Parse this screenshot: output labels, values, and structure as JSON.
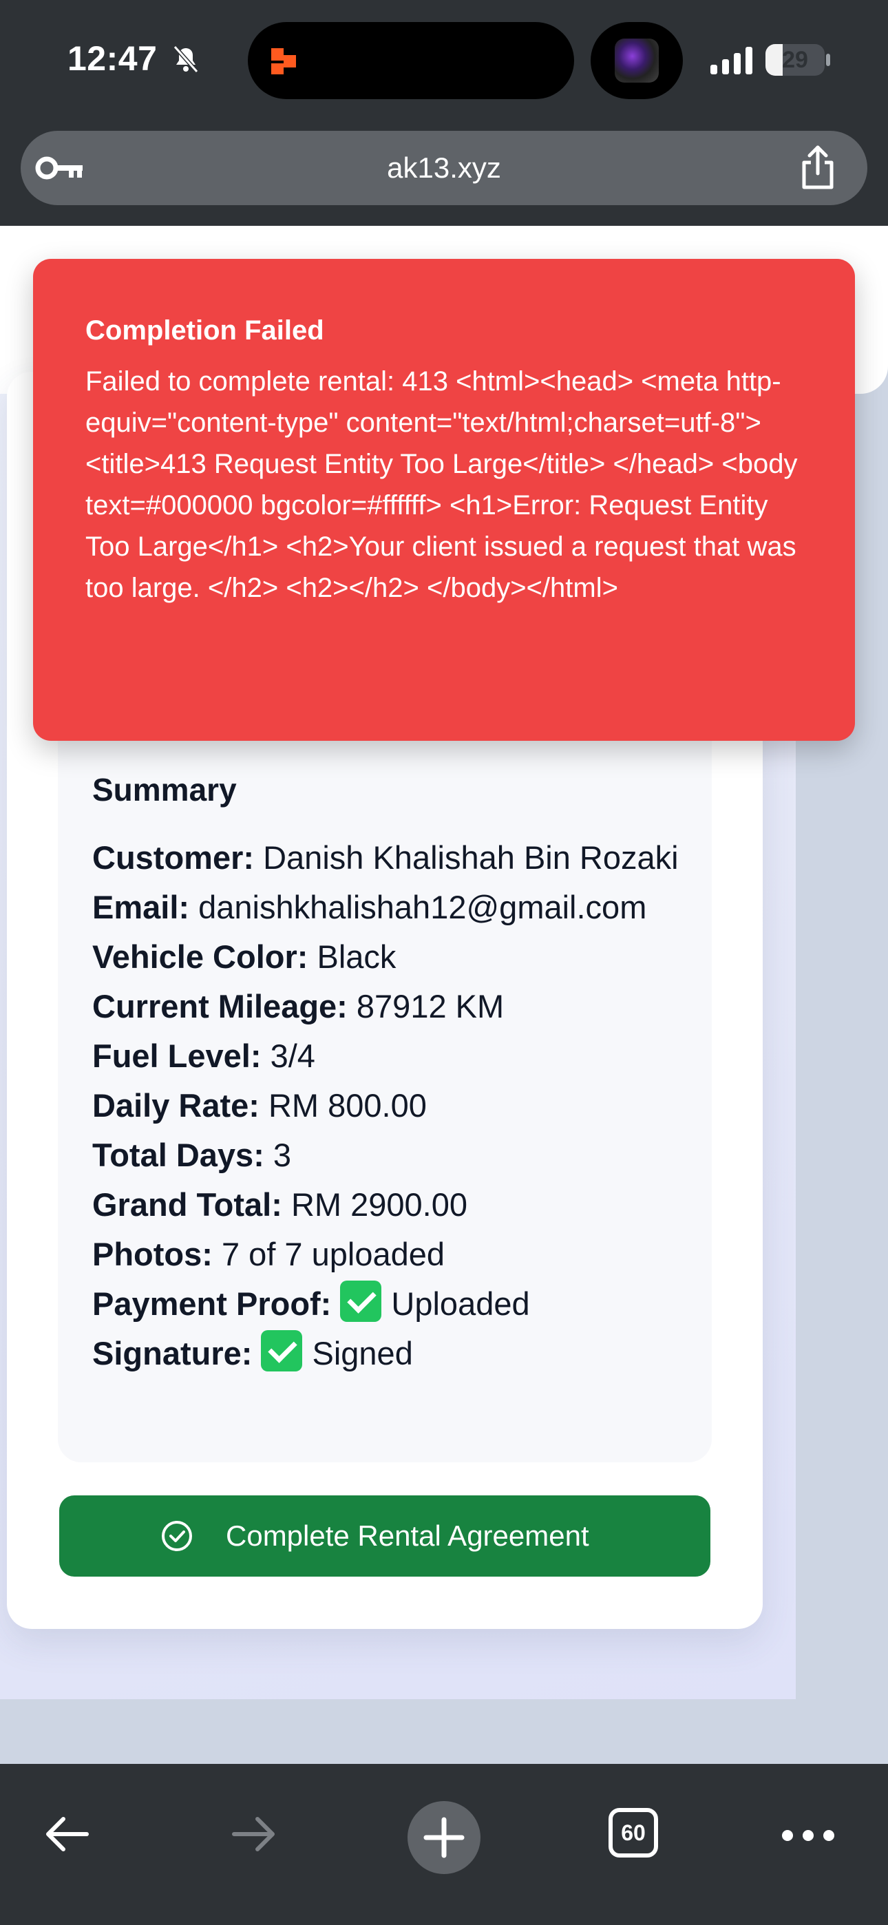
{
  "status_bar": {
    "time": "12:47",
    "battery": "29",
    "battery_fraction": 0.29,
    "icons": [
      "bell-slash-icon",
      "app-activity-icon",
      "now-playing-art",
      "signal-icon",
      "battery-icon"
    ]
  },
  "browser": {
    "url": "ak13.xyz",
    "icons": [
      "key-icon",
      "share-icon"
    ],
    "toolbar": {
      "tab_count": "60",
      "icons": [
        "back-arrow-icon",
        "forward-arrow-icon",
        "plus-icon",
        "tabs-icon",
        "more-icon"
      ]
    }
  },
  "toast": {
    "title": "Completion Failed",
    "message": "Failed to complete rental: 413 <html><head> <meta http-equiv=\"content-type\" content=\"text/html;charset=utf-8\"> <title>413 Request Entity Too Large</title> </head> <body text=#000000 bgcolor=#ffffff> <h1>Error: Request Entity Too Large</h1> <h2>Your client issued a request that was too large. </h2> <h2></h2> </body></html>",
    "color": "#ef4444"
  },
  "summary": {
    "title": "Summary",
    "rows": [
      {
        "label": "Customer:",
        "value": "Danish Khalishah Bin Rozaki"
      },
      {
        "label": "Email:",
        "value": "danishkhalishah12@gmail.com"
      },
      {
        "label": "Vehicle Color:",
        "value": "Black"
      },
      {
        "label": "Current Mileage:",
        "value": "87912 KM"
      },
      {
        "label": "Fuel Level:",
        "value": "3/4"
      },
      {
        "label": "Daily Rate:",
        "value": "RM 800.00"
      },
      {
        "label": "Total Days:",
        "value": "3"
      },
      {
        "label": "Grand Total:",
        "value": "RM 2900.00"
      },
      {
        "label": "Photos:",
        "value": "7 of 7 uploaded"
      },
      {
        "label": "Payment Proof:",
        "value": "Uploaded",
        "icon": "check-mark-icon"
      },
      {
        "label": "Signature:",
        "value": "Signed",
        "icon": "check-mark-icon"
      }
    ]
  },
  "actions": {
    "complete_label": "Complete Rental Agreement",
    "complete_icon": "check-circle-icon",
    "complete_color": "#188340"
  }
}
